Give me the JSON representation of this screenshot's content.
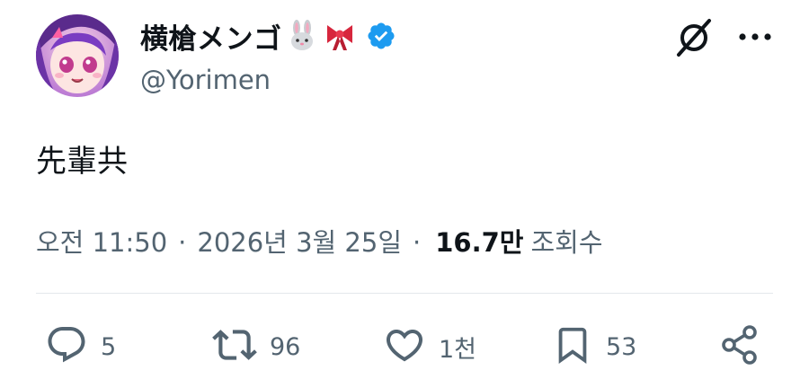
{
  "author": {
    "display_name": "横槍メンゴ",
    "emoji_badges": [
      "rabbit-emoji",
      "ribbon-emoji"
    ],
    "verified": true,
    "handle": "@Yorimen"
  },
  "tweet": {
    "text": "先輩共"
  },
  "meta": {
    "time": "오전 11:50",
    "dot1": "·",
    "date": "2026년 3월 25일",
    "dot2": "·",
    "views_count": "16.7만",
    "views_label": "조회수"
  },
  "actions": {
    "replies": "5",
    "reposts": "96",
    "likes": "1천",
    "bookmarks": "53"
  },
  "colors": {
    "text_primary": "#0f1419",
    "text_secondary": "#536471",
    "verified_blue": "#1d9bf0",
    "divider": "#e4e8eb"
  },
  "icons": [
    "grok-icon",
    "more-icon",
    "reply-icon",
    "repost-icon",
    "like-icon",
    "bookmark-icon",
    "share-icon"
  ]
}
